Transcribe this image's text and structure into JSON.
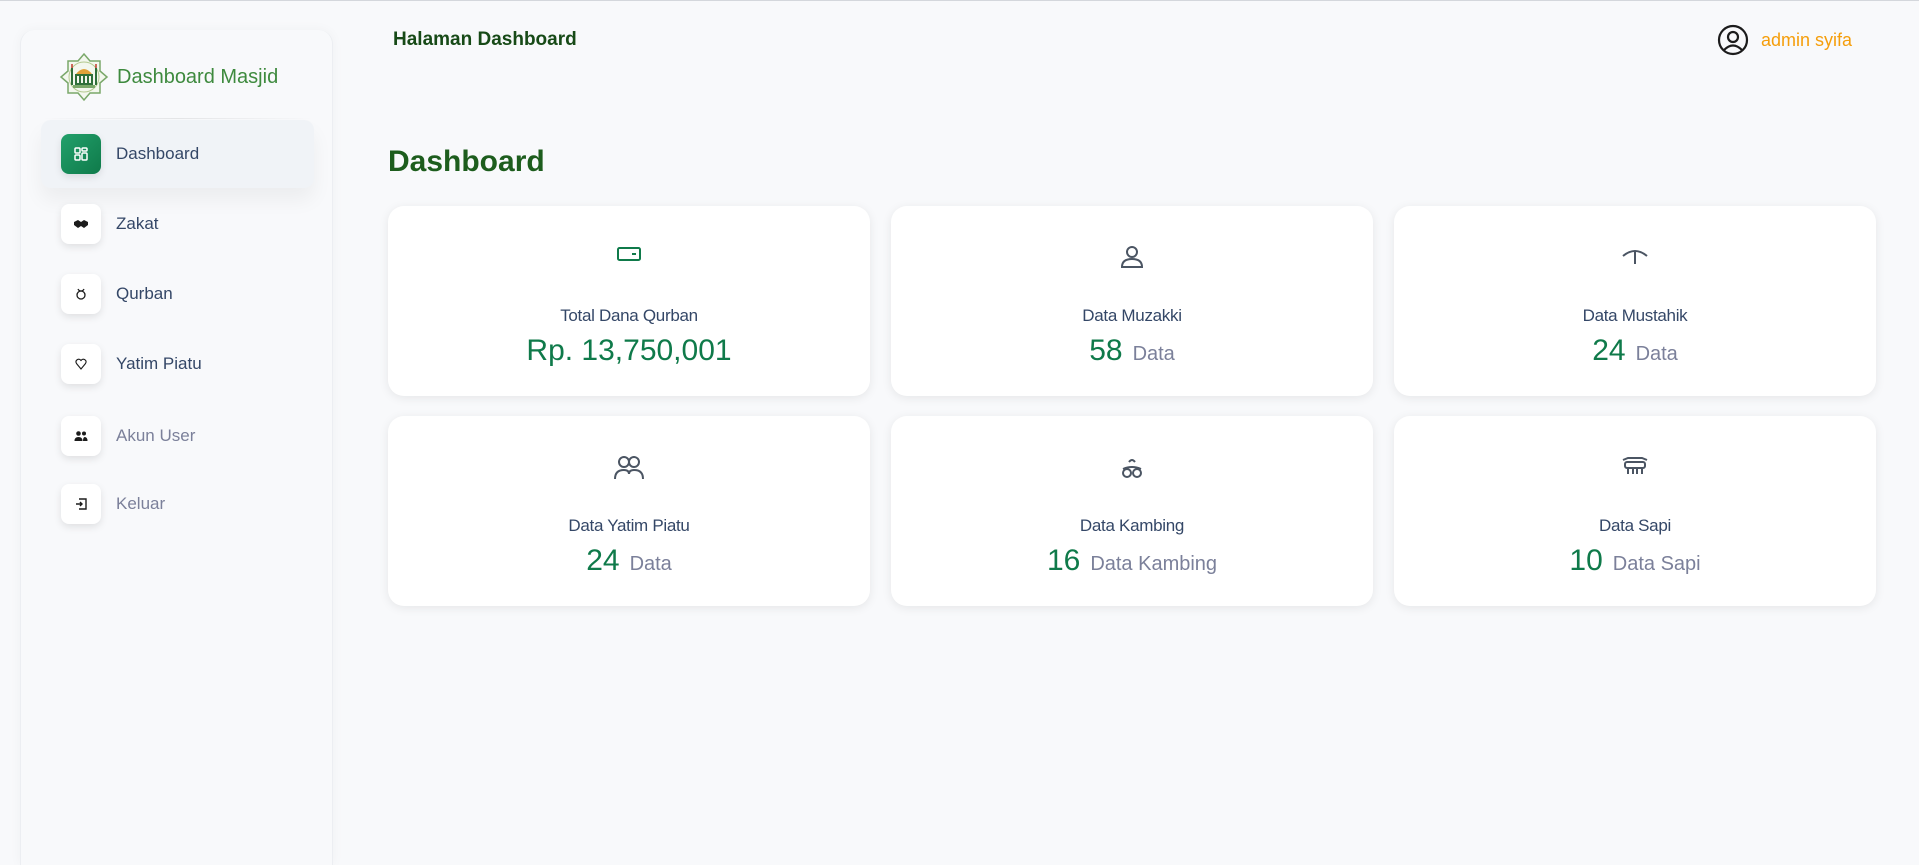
{
  "sidebar": {
    "brand": "Dashboard Masjid",
    "items": [
      {
        "label": "Dashboard",
        "icon": "grid-icon",
        "active": true
      },
      {
        "label": "Zakat",
        "icon": "handshake-icon"
      },
      {
        "label": "Qurban",
        "icon": "goat-icon"
      },
      {
        "label": "Yatim Piatu",
        "icon": "heart-icon"
      },
      {
        "label": "Akun User",
        "icon": "users-icon"
      },
      {
        "label": "Keluar",
        "icon": "logout-icon"
      }
    ]
  },
  "header": {
    "title": "Halaman Dashboard",
    "user": "admin syifa"
  },
  "main": {
    "title": "Dashboard",
    "cards": [
      {
        "label": "Total Dana Qurban",
        "value": "Rp. 13,750,001",
        "unit": "",
        "icon": "wallet-icon"
      },
      {
        "label": "Data Muzakki",
        "value": "58",
        "unit": "Data",
        "icon": "user-icon"
      },
      {
        "label": "Data Mustahik",
        "value": "24",
        "unit": "Data",
        "icon": "umbrella-icon"
      },
      {
        "label": "Data Yatim Piatu",
        "value": "24",
        "unit": "Data",
        "icon": "users-icon"
      },
      {
        "label": "Data Kambing",
        "value": "16",
        "unit": "Data Kambing",
        "icon": "goat-icon"
      },
      {
        "label": "Data Sapi",
        "value": "10",
        "unit": "Data Sapi",
        "icon": "cow-icon"
      }
    ]
  },
  "colors": {
    "accent_green": "#0f7a4a",
    "brand_green": "#3e8a3e",
    "user_orange": "#f59e0b"
  }
}
